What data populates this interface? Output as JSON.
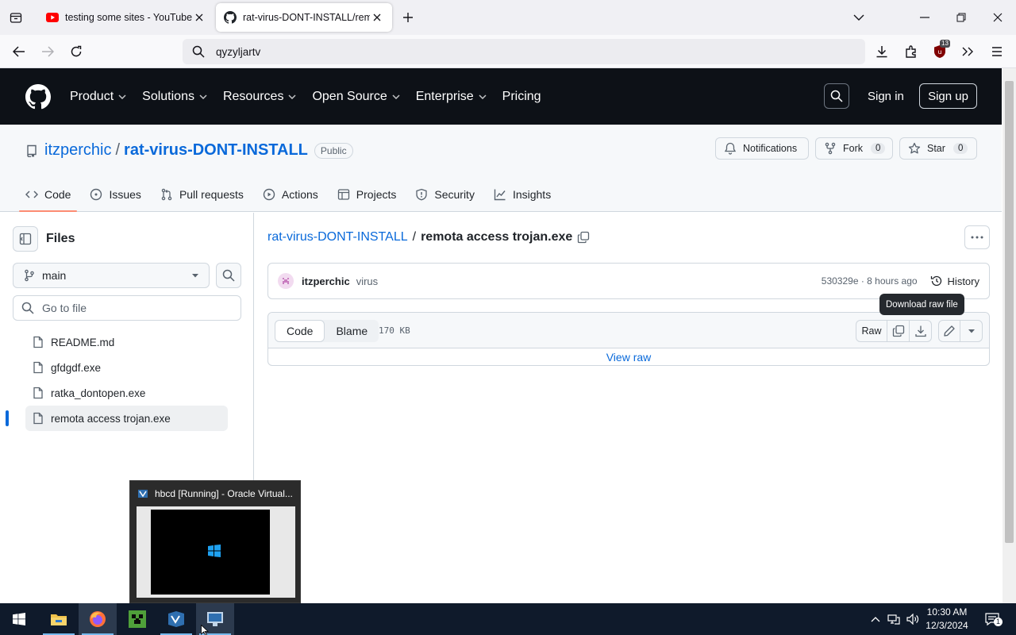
{
  "browser": {
    "tabs": [
      {
        "title": "testing some sites - YouTube",
        "icon": "youtube-icon"
      },
      {
        "title": "rat-virus-DONT-INSTALL/remota access trojan.exe",
        "icon": "github-icon",
        "active": true
      }
    ],
    "url": "qyzyljartv",
    "extension_badge": "13"
  },
  "gh_header": {
    "nav": [
      "Product",
      "Solutions",
      "Resources",
      "Open Source",
      "Enterprise",
      "Pricing"
    ],
    "sign_in": "Sign in",
    "sign_up": "Sign up"
  },
  "repo": {
    "owner": "itzperchic",
    "separator": "/",
    "name": "rat-virus-DONT-INSTALL",
    "visibility": "Public",
    "notifications": "Notifications",
    "fork_label": "Fork",
    "fork_count": "0",
    "star_label": "Star",
    "star_count": "0",
    "tabs": [
      "Code",
      "Issues",
      "Pull requests",
      "Actions",
      "Projects",
      "Security",
      "Insights"
    ]
  },
  "sidebar": {
    "title": "Files",
    "branch": "main",
    "goto_placeholder": "Go to file",
    "files": [
      "README.md",
      "gfdgdf.exe",
      "ratka_dontopen.exe",
      "remota access trojan.exe"
    ]
  },
  "main": {
    "crumb_repo": "rat-virus-DONT-INSTALL",
    "crumb_sep": "/",
    "crumb_file": "remota access trojan.exe",
    "commit_author": "itzperchic",
    "commit_message": "virus",
    "commit_meta": "530329e · 8 hours ago",
    "history": "History",
    "tooltip": "Download raw file",
    "view_code": "Code",
    "view_blame": "Blame",
    "file_size": "170 KB",
    "raw": "Raw",
    "view_raw": "View raw"
  },
  "preview": {
    "title": "hbcd [Running] - Oracle Virtual..."
  },
  "taskbar": {
    "time": "10:30 AM",
    "date": "12/3/2024",
    "notification_count": "1"
  }
}
